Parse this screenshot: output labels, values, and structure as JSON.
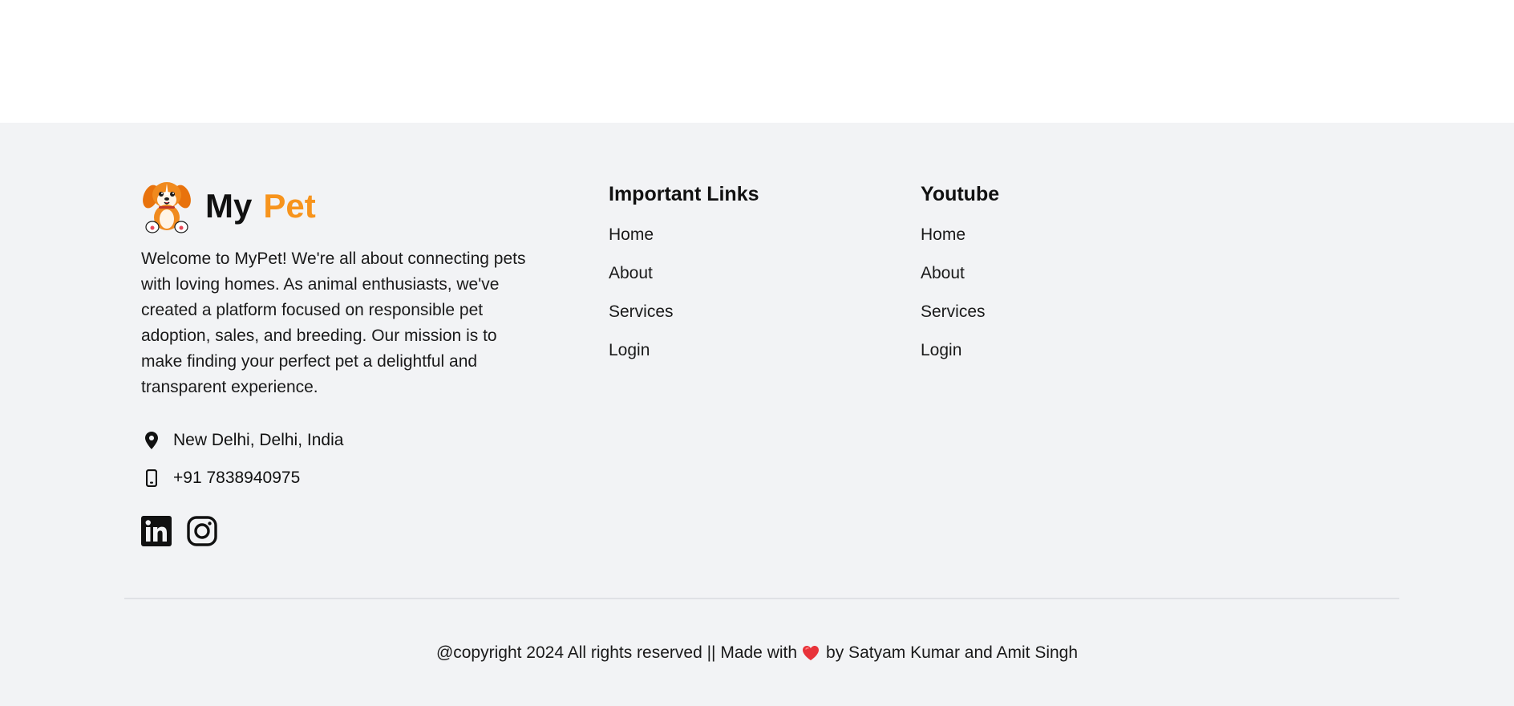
{
  "brand": {
    "name_part1": "My",
    "name_part2": "Pet",
    "accent_color": "#f7941d",
    "logo_icon": "puppy-logo-icon"
  },
  "about": {
    "text": "Welcome to MyPet! We're all about connecting pets with loving homes. As animal enthusiasts, we've created a platform focused on responsible pet adoption, sales, and breeding. Our mission is to make finding your perfect pet a delightful and transparent experience."
  },
  "contact": {
    "address": "New Delhi, Delhi, India",
    "phone": "+91 7838940975",
    "address_icon": "map-pin-icon",
    "phone_icon": "mobile-phone-icon"
  },
  "social": [
    {
      "name": "linkedin",
      "icon": "linkedin-icon"
    },
    {
      "name": "instagram",
      "icon": "instagram-icon"
    }
  ],
  "important_links": {
    "heading": "Important Links",
    "items": [
      "Home",
      "About",
      "Services",
      "Login"
    ]
  },
  "youtube_links": {
    "heading": "Youtube",
    "items": [
      "Home",
      "About",
      "Services",
      "Login"
    ]
  },
  "footer_bottom": {
    "copyright_prefix": "@copyright 2024 All rights reserved || Made with",
    "copyright_suffix": "by Satyam Kumar and Amit Singh",
    "heart_icon": "heart-icon",
    "heart_color": "#e8333a"
  }
}
